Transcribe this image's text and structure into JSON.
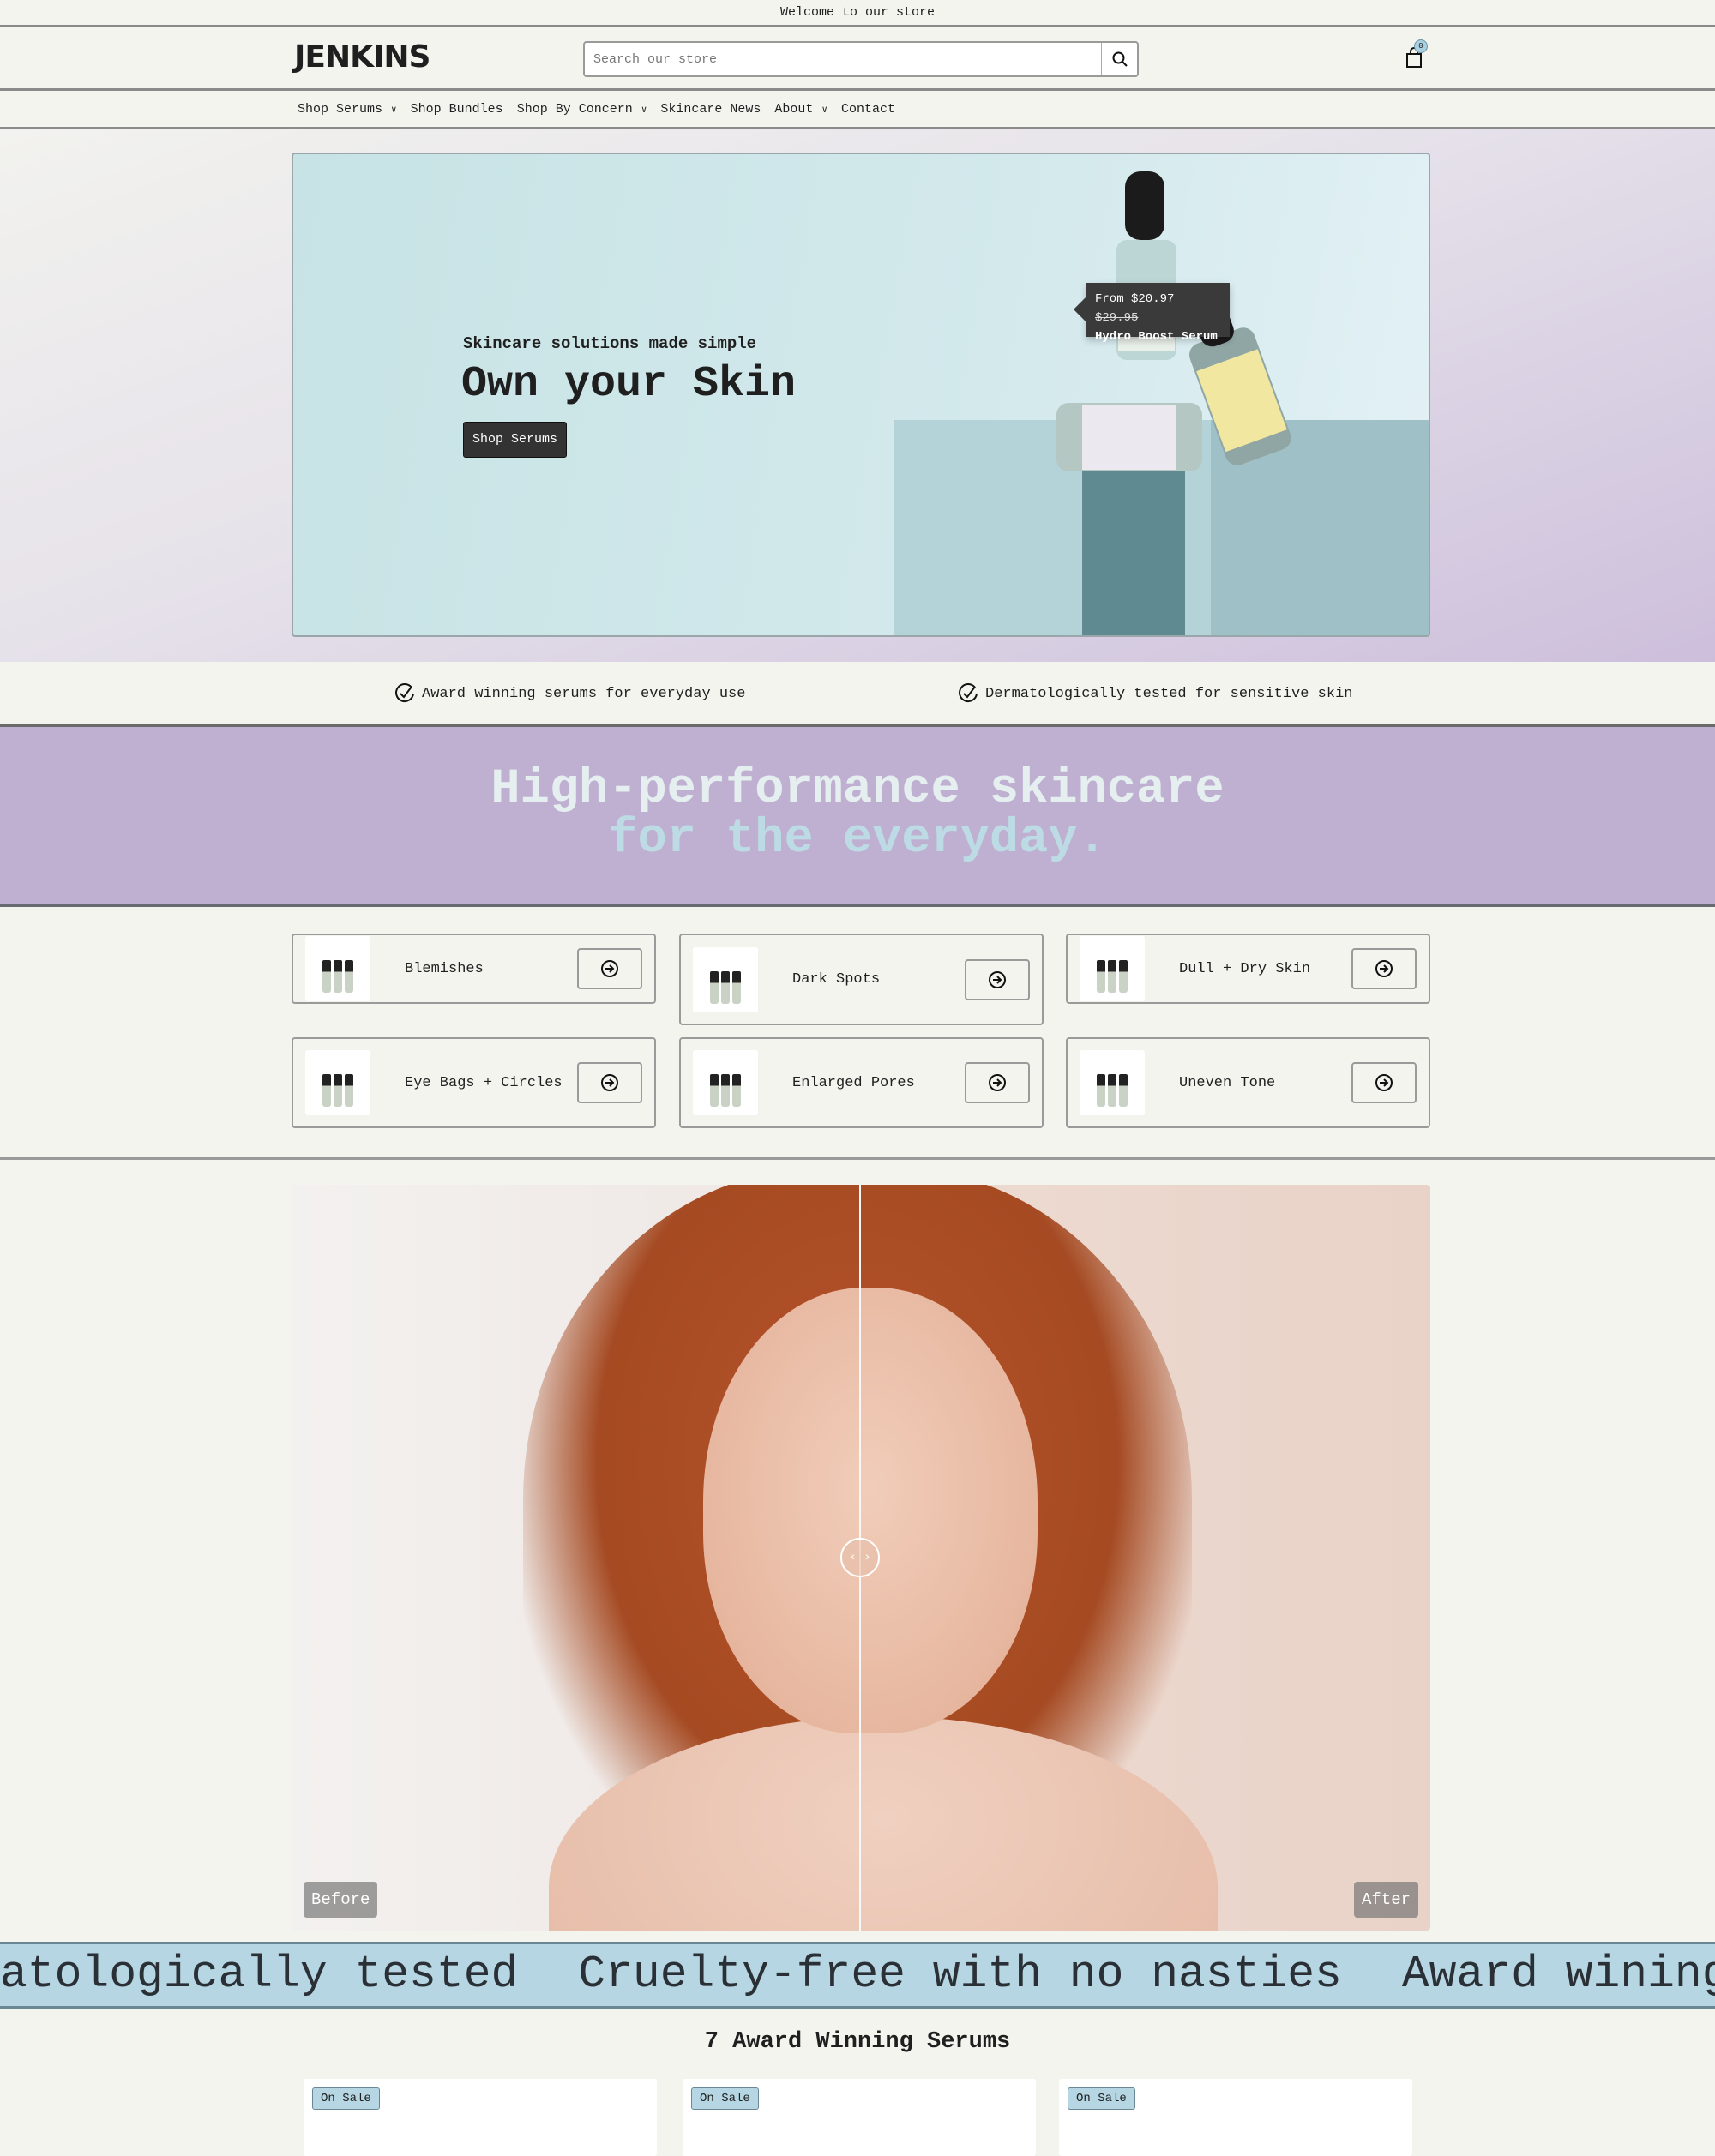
{
  "announcement": "Welcome to our store",
  "header": {
    "logo": "JENKINS",
    "search_placeholder": "Search our store",
    "cart_count": "0"
  },
  "nav": [
    {
      "label": "Shop Serums",
      "dropdown": true
    },
    {
      "label": "Shop Bundles",
      "dropdown": false
    },
    {
      "label": "Shop By Concern",
      "dropdown": true
    },
    {
      "label": "Skincare News",
      "dropdown": false
    },
    {
      "label": "About",
      "dropdown": true
    },
    {
      "label": "Contact",
      "dropdown": false
    }
  ],
  "hero": {
    "subtitle": "Skincare solutions made simple",
    "title": "Own your Skin",
    "cta": "Shop Serums",
    "tooltip": {
      "price_prefix": "From $20.97",
      "compare_price": "$29.95",
      "product": "Hydro Boost Serum"
    }
  },
  "features": [
    "Award winning serums for everyday use",
    "Dermatologically tested for sensitive skin"
  ],
  "band": {
    "line1": "High-performance skincare",
    "line2": "for the everyday."
  },
  "concerns": [
    "Blemishes",
    "Dark Spots",
    "Dull + Dry Skin",
    "Eye Bags + Circles",
    "Enlarged Pores",
    "Uneven Tone"
  ],
  "compare": {
    "before": "Before",
    "after": "After"
  },
  "marquee": [
    "atologically tested",
    "Cruelty-free with no nasties",
    "Award wining"
  ],
  "products": {
    "title": "7 Award Winning Serums",
    "badge": "On Sale"
  },
  "colors": {
    "band": "#bfb0d2",
    "marquee": "#b5d6e2",
    "hero": "#cde5e8",
    "button": "#333333"
  }
}
